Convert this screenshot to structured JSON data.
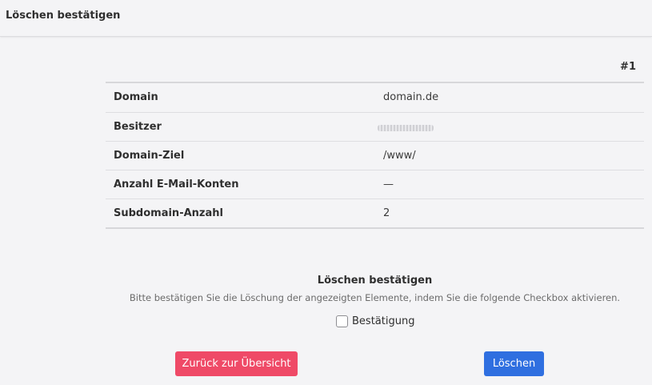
{
  "header": {
    "title": "Löschen bestätigen"
  },
  "table": {
    "column_header": "#1",
    "rows": [
      {
        "label": "Domain",
        "value": "domain.de"
      },
      {
        "label": "Besitzer",
        "value": ""
      },
      {
        "label": "Domain-Ziel",
        "value": "/www/"
      },
      {
        "label": "Anzahl E-Mail-Konten",
        "value": "—"
      },
      {
        "label": "Subdomain-Anzahl",
        "value": "2"
      }
    ]
  },
  "confirm": {
    "title": "Löschen bestätigen",
    "description": "Bitte bestätigen Sie die Löschung der angezeigten Elemente, indem Sie die folgende Checkbox aktivieren.",
    "checkbox_label": "Bestätigung",
    "checked": false
  },
  "buttons": {
    "back_label": "Zurück zur Übersicht",
    "delete_label": "Löschen"
  },
  "colors": {
    "back_button": "#ef4a67",
    "delete_button": "#2f6fe0"
  }
}
